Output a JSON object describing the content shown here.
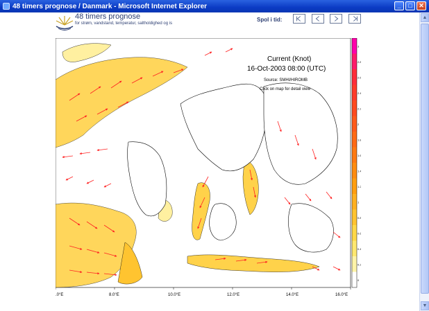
{
  "window": {
    "title": "48 timers prognose / Danmark - Microsoft Internet Explorer",
    "min_glyph": "_",
    "max_glyph": "□",
    "close_glyph": "✕"
  },
  "header": {
    "brand_title": "48 timers prognose",
    "brand_subtitle": "for strøm, vandstand, temperatur, saltholdighed og is",
    "playback_label": "Spol i tid:",
    "buttons": [
      {
        "id": "first",
        "glyph": "|<"
      },
      {
        "id": "prev",
        "glyph": "<"
      },
      {
        "id": "next",
        "glyph": ">"
      },
      {
        "id": "last",
        "glyph": ">|"
      }
    ]
  },
  "map": {
    "title": "Current (Knot)",
    "datetime": "16-Oct-2003 08:00 (UTC)",
    "source": "Source: SMHI/HIROMB",
    "hint": "Click on map for detail view",
    "x_ticks": [
      ".0°E",
      "8.0°E",
      "10.0°E",
      "12.0°E",
      "14.0°E",
      "16.0°E"
    ],
    "colorbar": {
      "ticks": [
        "3",
        "2.8",
        "2.6",
        "2.4",
        "2.2",
        "2",
        "1.8",
        "1.6",
        "1.4",
        "1.2",
        "1",
        "0.8",
        "0.6",
        "0.4",
        "0.2",
        "0"
      ],
      "colors": [
        "#ff00aa",
        "#ff1a6b",
        "#ff2d3a",
        "#ff3b2a",
        "#ff4a1e",
        "#ff5a1a",
        "#ff6a15",
        "#ff7a12",
        "#ff8c10",
        "#ff9e10",
        "#ffb020",
        "#ffc430",
        "#ffd848",
        "#ffe870",
        "#fff4a8",
        "#ffffff"
      ]
    },
    "colors": {
      "land": "#ffffff",
      "coast": "#000000",
      "shallow": "#ffd24a",
      "shallow_light": "#fff0a0",
      "arrow": "#ff2222"
    }
  }
}
